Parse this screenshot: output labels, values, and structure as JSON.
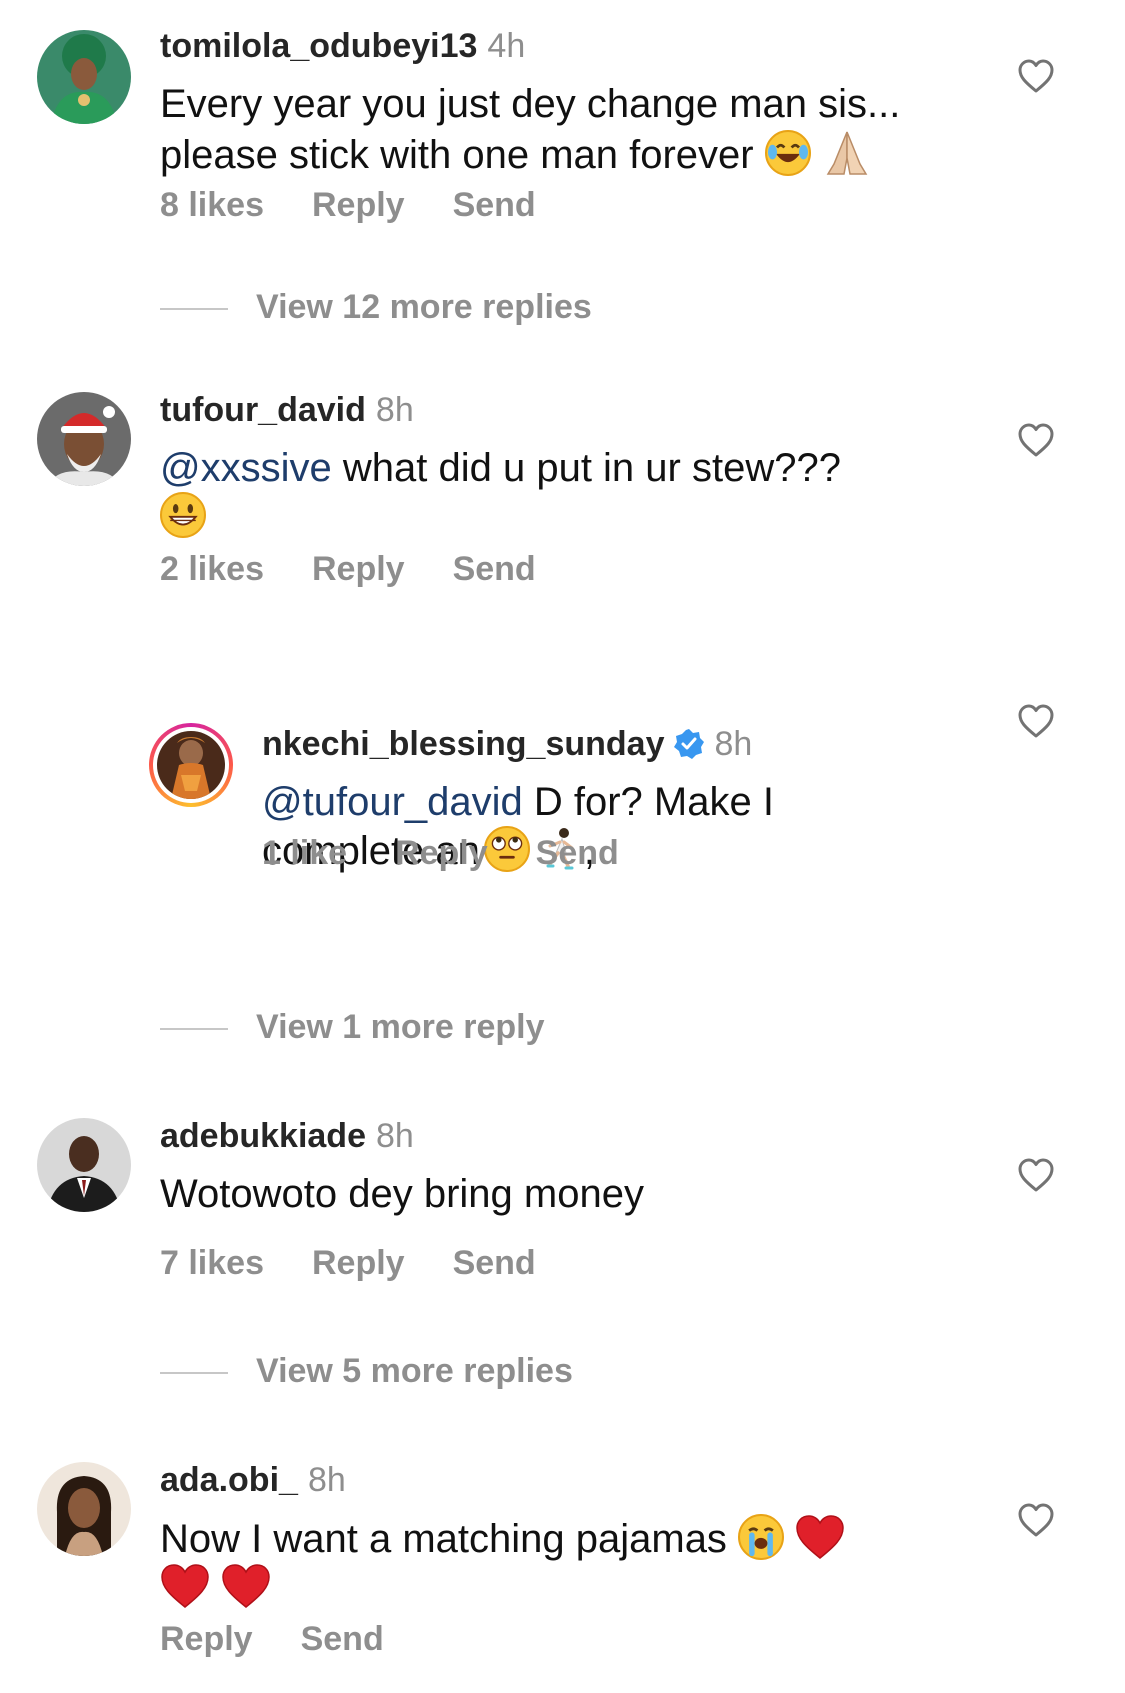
{
  "comments": [
    {
      "username": "tomilola_odubeyi13",
      "time": "4h",
      "text_line1": "Every year you just dey change man sis...",
      "text_line2": "please stick with one man forever",
      "emojis": [
        "tears-of-joy-emoji",
        "folded-hands-emoji"
      ],
      "likes": "8 likes",
      "reply": "Reply",
      "send": "Send",
      "view_replies": "View 12 more replies"
    },
    {
      "username": "tufour_david",
      "time": "8h",
      "mention": "@xxssive",
      "text": " what did u put in ur stew???",
      "emojis": [
        "grinning-face-emoji"
      ],
      "likes": "2 likes",
      "reply": "Reply",
      "send": "Send"
    },
    {
      "username": "nkechi_blessing_sunday",
      "verified": true,
      "time": "8h",
      "mention": "@tufour_david",
      "text_line1": " D for?  Make I",
      "text_line2": "complete an",
      "emojis": [
        "rolling-eyes-emoji",
        "running-woman-emoji"
      ],
      "trailing": ",",
      "likes": "1 like",
      "reply": "Reply",
      "send": "Send",
      "view_replies": "View 1 more reply"
    },
    {
      "username": "adebukkiade",
      "time": "8h",
      "text": "Wotowoto dey bring money",
      "likes": "7 likes",
      "reply": "Reply",
      "send": "Send",
      "view_replies": "View 5 more replies"
    },
    {
      "username": "ada.obi_",
      "time": "8h",
      "text": "Now I want a matching pajamas",
      "emojis": [
        "loudly-crying-emoji",
        "red-heart-emoji",
        "red-heart-emoji",
        "red-heart-emoji"
      ],
      "reply": "Reply",
      "send": "Send"
    }
  ],
  "colors": {
    "username": "#262626",
    "muted": "#8e8e8e",
    "mention": "#1e3d6b",
    "verified": "#3897f0"
  }
}
